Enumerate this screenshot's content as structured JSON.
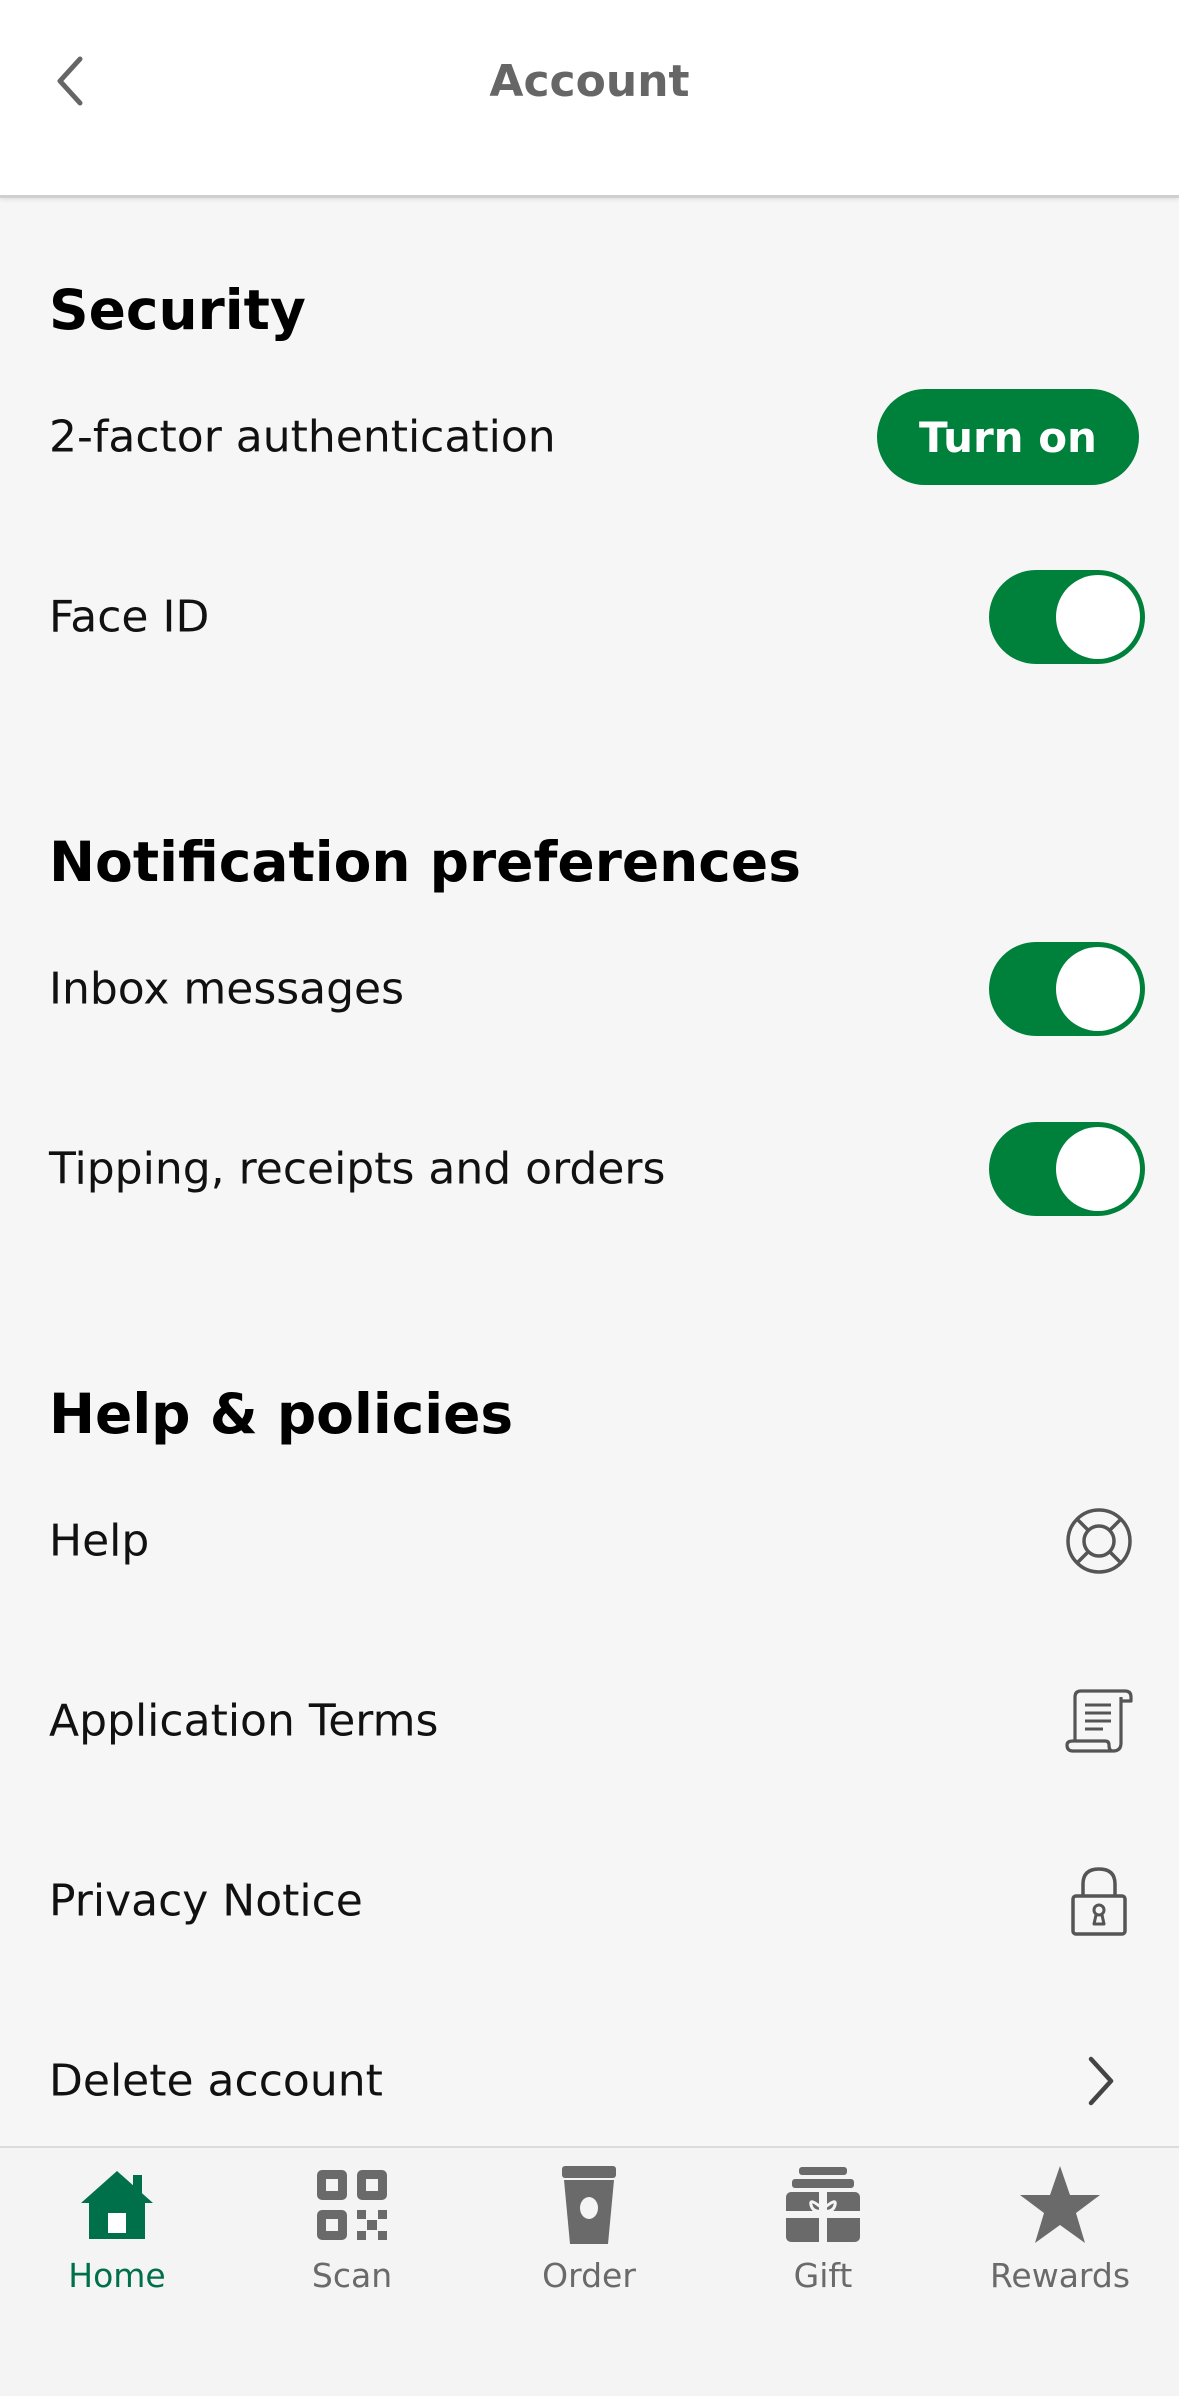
{
  "header": {
    "title": "Account",
    "back_icon": "chevron-left-icon"
  },
  "sections": {
    "security": {
      "heading": "Security",
      "two_factor": {
        "label": "2-factor authentication",
        "button_label": "Turn on"
      },
      "face_id": {
        "label": "Face ID",
        "enabled": true
      }
    },
    "notifications": {
      "heading": "Notification preferences",
      "inbox": {
        "label": "Inbox messages",
        "enabled": true
      },
      "tipping": {
        "label": "Tipping, receipts and orders",
        "enabled": true
      }
    },
    "help": {
      "heading": "Help & policies",
      "items": [
        {
          "label": "Help",
          "icon": "lifebuoy-icon"
        },
        {
          "label": "Application Terms",
          "icon": "scroll-document-icon"
        },
        {
          "label": "Privacy Notice",
          "icon": "padlock-icon"
        },
        {
          "label": "Delete account",
          "icon": "chevron-right-icon"
        }
      ]
    }
  },
  "tabbar": {
    "tabs": [
      {
        "label": "Home",
        "icon": "home-icon",
        "active": true
      },
      {
        "label": "Scan",
        "icon": "qr-code-icon",
        "active": false
      },
      {
        "label": "Order",
        "icon": "cup-icon",
        "active": false
      },
      {
        "label": "Gift",
        "icon": "gift-card-icon",
        "active": false
      },
      {
        "label": "Rewards",
        "icon": "star-icon",
        "active": false
      }
    ]
  },
  "colors": {
    "accent": "#00813b",
    "home_active": "#00704a",
    "inactive": "#6a6a6a",
    "background": "#f6f6f6"
  }
}
